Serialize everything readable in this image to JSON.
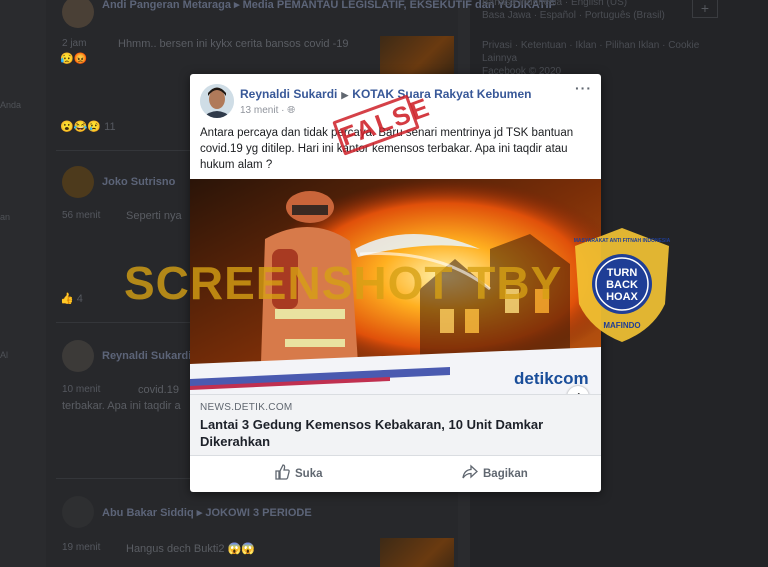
{
  "background_feed": {
    "post1": {
      "author": "Andi Pangeran Metaraga",
      "target": "Media PEMANTAU LEGISLATIF, EKSEKUTIF dan YUDIKATIF",
      "time": "2 jam",
      "text": "Hhmm.. bersen ini kykx cerita bansos covid -19",
      "reactions_count": "11"
    },
    "post2": {
      "author": "Joko Sutrisno",
      "time": "56 menit",
      "text": "Seperti nya"
    },
    "post3": {
      "author": "Reynaldi Sukardi",
      "time": "10 menit",
      "text": "covid.19",
      "text2": "terbakar. Apa ini taqdir a"
    },
    "post4": {
      "author": "Abu Bakar Siddiq",
      "target": "JOKOWI 3 PERIODE",
      "time": "19 menit",
      "text": "Hangus dech Bukti2"
    },
    "side_labels": [
      "Anda",
      "an",
      "Al"
    ],
    "reaction_count_mid": "4",
    "right_column": {
      "languages_line1": "Bahasa Indonesia · English (US)",
      "languages_line2": "Basa Jawa · Español · Português (Brasil)",
      "footer_line1": "Privasi · Ketentuan · Iklan · Pilihan Iklan · Cookie",
      "footer_line2": "Lainnya",
      "copyright": "Facebook © 2020"
    }
  },
  "post": {
    "author": "Reynaldi Sukardi",
    "group": "KOTAK Suara Rakyat Kebumen",
    "time": "13 menit",
    "text": "Antara percaya dan tidak percaya. Baru senari mentrinya jd TSK bantuan covid.19 yg ditilep. Hari ini kantor kemensos terbakar. Apa ini taqdir atau hukum alam ?",
    "image_brand": "detikcom",
    "link_domain": "NEWS.DETIK.COM",
    "link_title": "Lantai 3 Gedung Kemensos Kebakaran, 10 Unit Damkar Dikerahkan",
    "like_label": "Suka",
    "share_label": "Bagikan",
    "info_label": "i"
  },
  "stamp": "FALSE",
  "watermark": "SCREENSHOT TBY",
  "badge": {
    "top_arc": "MASYARAKAT ANTI FITNAH INDONESIA",
    "line1": "TURN",
    "line2": "BACK",
    "line3": "HOAX",
    "bottom_arc": "MAFINDO"
  },
  "colors": {
    "link_blue": "#385898",
    "stamp_red": "#ce2028",
    "watermark_gold": "#d6a014",
    "badge_blue": "#1f3e96",
    "badge_gold": "#f2c233"
  }
}
